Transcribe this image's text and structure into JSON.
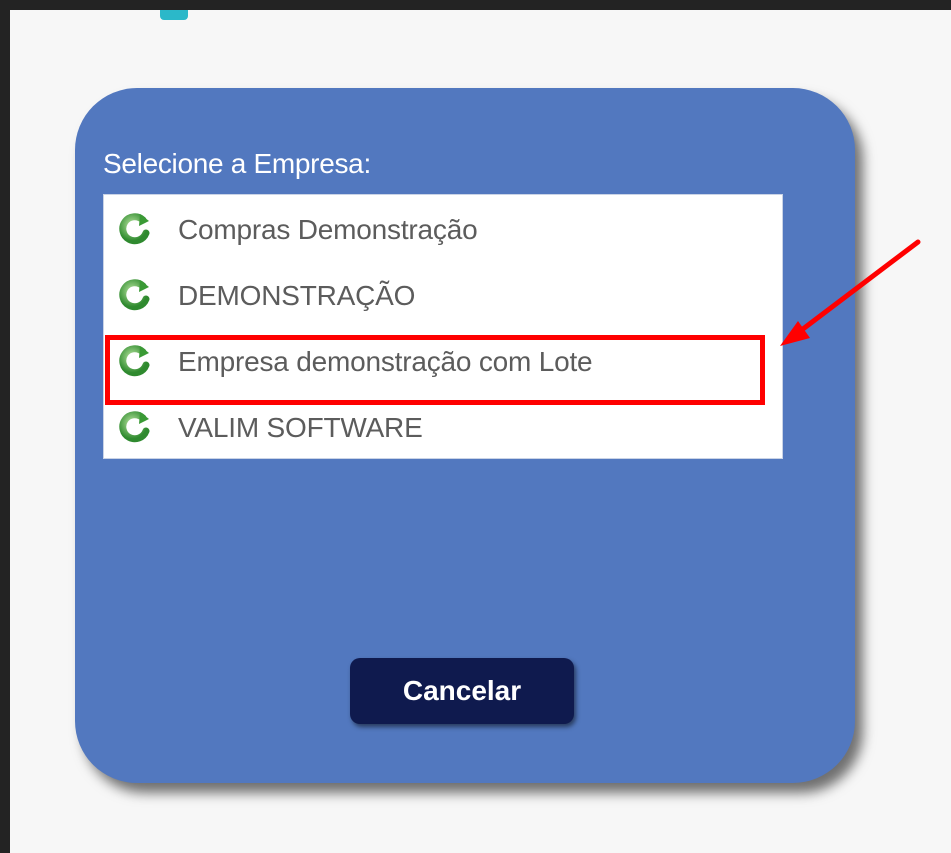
{
  "dialog": {
    "title": "Selecione a Empresa:",
    "companies": [
      {
        "label": "Compras Demonstração",
        "icon": "refresh-icon"
      },
      {
        "label": "DEMONSTRAÇÃO",
        "icon": "refresh-icon"
      },
      {
        "label": "Empresa demonstração com Lote",
        "icon": "refresh-icon",
        "highlighted": true
      },
      {
        "label": "VALIM SOFTWARE",
        "icon": "refresh-icon"
      }
    ],
    "cancel_label": "Cancelar"
  },
  "colors": {
    "dialog_background": "#5278bf",
    "cancel_button": "#0f1a4e",
    "highlight": "#ff0000",
    "icon_green": "#3f9a3a"
  }
}
